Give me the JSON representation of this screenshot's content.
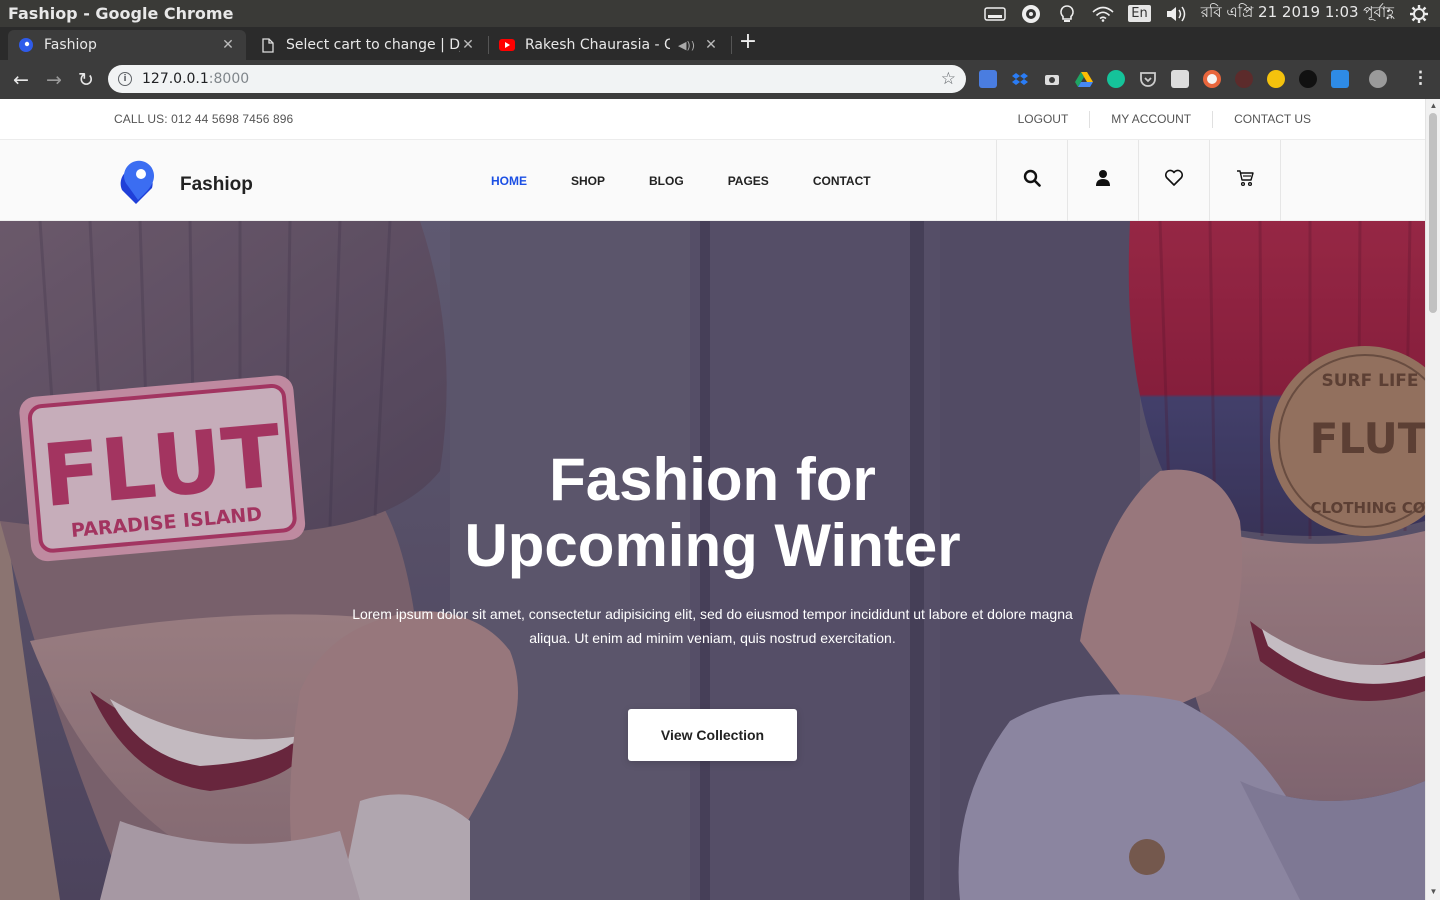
{
  "os": {
    "window_title": "Fashiop - Google Chrome",
    "language_indicator": "En",
    "datetime": "রবি এপ্রি 21 2019 1:03 পূর্বাহ্ণ",
    "tray_icons": [
      "display-icon",
      "eye-icon",
      "lightbulb-icon",
      "wifi-icon",
      "keyboard-language-icon",
      "volume-icon",
      "settings-gear-icon"
    ]
  },
  "browser": {
    "tabs": [
      {
        "title": "Fashiop",
        "active": true,
        "favicon": "fashiop-logo-icon"
      },
      {
        "title": "Select cart to change | Dja",
        "active": false,
        "favicon": "document-icon"
      },
      {
        "title": "Rakesh Chaurasia - Cla",
        "active": false,
        "favicon": "youtube-icon",
        "playing_audio": true
      }
    ],
    "url_host": "127.0.0.1",
    "url_port": ":8000",
    "extensions": [
      "google-translate-icon",
      "dropbox-icon",
      "camera-icon",
      "google-drive-icon",
      "grammarly-icon",
      "pocket-icon",
      "gmail-icon",
      "record-icon",
      "k-icon",
      "search-ext-icon",
      "dark-circle-icon",
      "tfp-icon",
      "profile-avatar-icon"
    ]
  },
  "topbar": {
    "call": "CALL US: 012 44 5698 7456 896",
    "links": [
      "LOGOUT",
      "MY ACCOUNT",
      "CONTACT US"
    ]
  },
  "header": {
    "brand": "Fashiop",
    "nav": [
      "HOME",
      "SHOP",
      "BLOG",
      "PAGES",
      "CONTACT"
    ],
    "active_nav": "HOME",
    "accent_color": "#1b4fe4",
    "icons": [
      "search-icon",
      "user-icon",
      "heart-icon",
      "cart-icon"
    ]
  },
  "hero": {
    "title_line1": "Fashion for",
    "title_line2": "Upcoming Winter",
    "text": "Lorem ipsum dolor sit amet, consectetur adipisicing elit, sed do eiusmod tempor incididunt ut labore et dolore magna aliqua. Ut enim ad minim veniam, quis nostrud exercitation.",
    "button": "View Collection",
    "patch_left_main": "FLUT",
    "patch_left_sub": "PARADISE ISLAND",
    "patch_right_top": "SURF LIFE",
    "patch_right_main": "FLUT",
    "patch_right_bottom": "CLOTHING CO"
  }
}
